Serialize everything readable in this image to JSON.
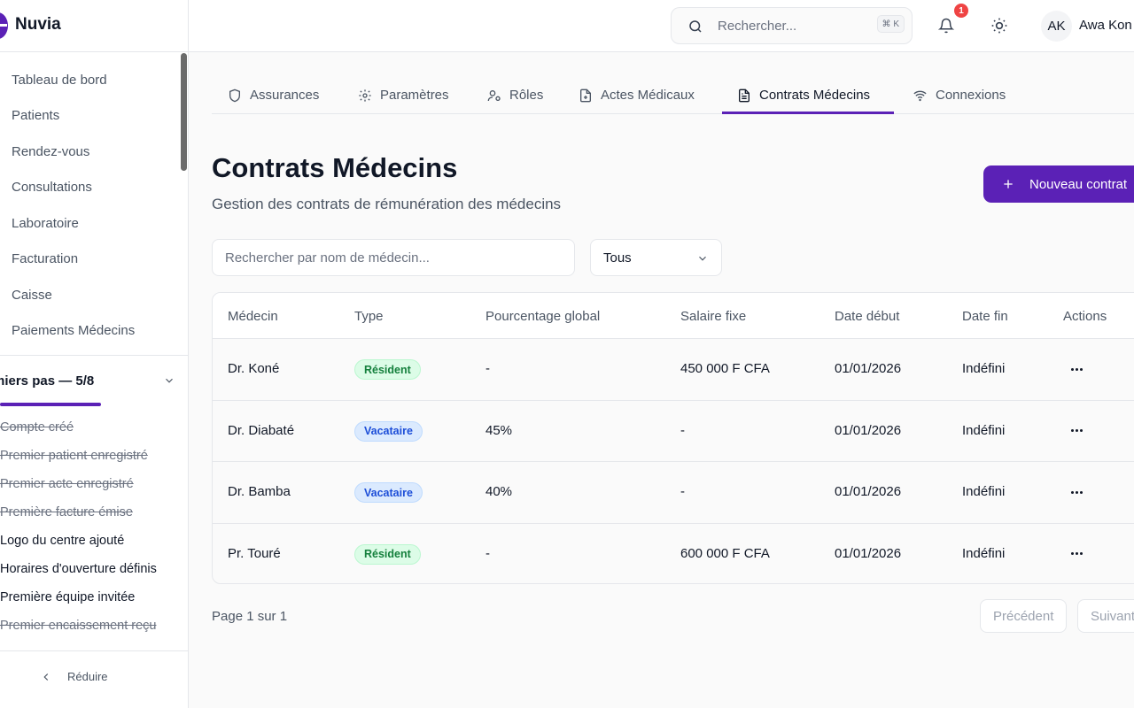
{
  "app": {
    "name": "Nuvia",
    "accent": "#5b21b6"
  },
  "sidebar": {
    "items": [
      {
        "label": "Tableau de bord"
      },
      {
        "label": "Patients"
      },
      {
        "label": "Rendez-vous"
      },
      {
        "label": "Consultations"
      },
      {
        "label": "Laboratoire"
      },
      {
        "label": "Facturation"
      },
      {
        "label": "Caisse"
      },
      {
        "label": "Paiements Médecins"
      }
    ],
    "onboarding": {
      "title": "miers pas — 5/8",
      "progress": 0.625,
      "steps": [
        {
          "label": "Compte créé",
          "done": true
        },
        {
          "label": "Premier patient enregistré",
          "done": true
        },
        {
          "label": "Premier acte enregistré",
          "done": true
        },
        {
          "label": "Première facture émise",
          "done": true
        },
        {
          "label": "Logo du centre ajouté",
          "done": false
        },
        {
          "label": "Horaires d'ouverture définis",
          "done": false
        },
        {
          "label": "Première équipe invitée",
          "done": false
        },
        {
          "label": "Premier encaissement reçu",
          "done": true
        }
      ]
    },
    "collapse_label": "Réduire"
  },
  "topbar": {
    "search_placeholder": "Rechercher...",
    "search_shortcut": "⌘ K",
    "notification_count": "1",
    "user_initials": "AK",
    "user_name": "Awa Kon"
  },
  "tabs": [
    {
      "label": "Assurances",
      "icon": "shield-icon",
      "active": false
    },
    {
      "label": "Paramètres",
      "icon": "gear-icon",
      "active": false
    },
    {
      "label": "Rôles",
      "icon": "user-gear-icon",
      "active": false
    },
    {
      "label": "Actes Médicaux",
      "icon": "file-medical-icon",
      "active": false
    },
    {
      "label": "Contrats Médecins",
      "icon": "document-icon",
      "active": true
    },
    {
      "label": "Connexions",
      "icon": "wifi-icon",
      "active": false
    }
  ],
  "page": {
    "title": "Contrats Médecins",
    "subtitle": "Gestion des contrats de rémunération des médecins",
    "new_button": "Nouveau contrat"
  },
  "filters": {
    "search_placeholder": "Rechercher par nom de médecin...",
    "type_selected": "Tous"
  },
  "table": {
    "headers": [
      "Médecin",
      "Type",
      "Pourcentage global",
      "Salaire fixe",
      "Date début",
      "Date fin",
      "Actions"
    ],
    "rows": [
      {
        "medecin": "Dr. Koné",
        "type": "Résident",
        "type_kind": "res",
        "pourcentage": "-",
        "salaire": "450 000 F CFA",
        "debut": "01/01/2026",
        "fin": "Indéfini"
      },
      {
        "medecin": "Dr. Diabaté",
        "type": "Vacataire",
        "type_kind": "vac",
        "pourcentage": "45%",
        "salaire": "-",
        "debut": "01/01/2026",
        "fin": "Indéfini"
      },
      {
        "medecin": "Dr. Bamba",
        "type": "Vacataire",
        "type_kind": "vac",
        "pourcentage": "40%",
        "salaire": "-",
        "debut": "01/01/2026",
        "fin": "Indéfini"
      },
      {
        "medecin": "Pr. Touré",
        "type": "Résident",
        "type_kind": "res",
        "pourcentage": "-",
        "salaire": "600 000 F CFA",
        "debut": "01/01/2026",
        "fin": "Indéfini"
      }
    ]
  },
  "pagination": {
    "label": "Page 1 sur 1",
    "prev": "Précédent",
    "next": "Suivant"
  }
}
